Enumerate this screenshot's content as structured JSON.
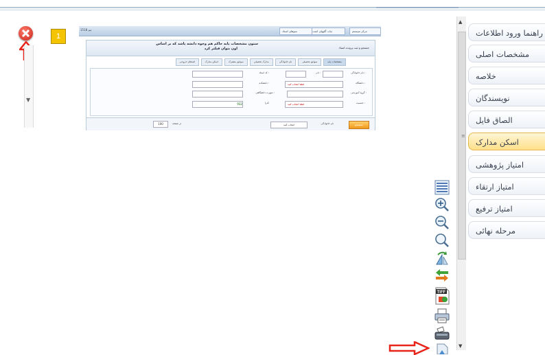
{
  "left_panel": {
    "badge_number": "1"
  },
  "embedded_form": {
    "toolbar": {
      "left_text": "1518 تيم",
      "buttons": [
        "منوهای اسناد",
        "ثبات گلپهای است",
        "سیستم",
        "مرکز سیستم"
      ]
    },
    "title_line1": "ستون مشخصات پایه حاکم هم وجوه دانشه پاشد که بر اساس",
    "title_line2": "اون بتوان فیلتر کرد",
    "header_right": "جستجو و ثبت پرونده استاد",
    "tabs": [
      "مشخصات پایه",
      "سوابق تحصیلی",
      "نام خانوادگی",
      "مدارک تحصیلی",
      "سوابق مشترک",
      "اسکن مدارک",
      "قیدهای خروجی"
    ],
    "labels": {
      "name": "نام :",
      "family": "نام خانوادگی :",
      "code": "کد استاد :",
      "university": "دانشگاه :",
      "faculty": "دانشکده :",
      "group": "گروه آموزشی :",
      "city": "شهرت دانشگاهی :",
      "rank": "جنسیت :",
      "year": "کدرا"
    },
    "select_placeholder": "لطفا انتخاب کنید",
    "year_value": "932",
    "footer": {
      "button": "جستجو",
      "page_label": "در صفحه",
      "page_value": "100",
      "filter_label": "نام خانوادگی",
      "filter_value": "انتخاب کنید"
    }
  },
  "toolbar_icons": [
    "list-icon",
    "zoom-in-icon",
    "zoom-out-icon",
    "zoom-reset-icon",
    "rotate-icon",
    "swap-arrows-icon",
    "tiff-file-icon",
    "print-icon",
    "scanner-icon",
    "page-icon"
  ],
  "nav": {
    "items": [
      {
        "label": "راهنما ورود اطلاعات",
        "active": false
      },
      {
        "label": "مشخصات اصلی",
        "active": false
      },
      {
        "label": "خلاصه",
        "active": false
      },
      {
        "label": "نویسندگان",
        "active": false
      },
      {
        "label": "الصاق فایل",
        "active": false
      },
      {
        "label": "اسکن مدارک",
        "active": true
      },
      {
        "label": "امتیاز پژوهشی",
        "active": false
      },
      {
        "label": "امتیاز ارتقاء",
        "active": false
      },
      {
        "label": "امتیاز ترفیع",
        "active": false
      },
      {
        "label": "مرحله نهائی",
        "active": false
      }
    ]
  },
  "colors": {
    "accent_red": "#e8231a",
    "active_tab": "#ffe08a",
    "badge": "#f5c400"
  }
}
